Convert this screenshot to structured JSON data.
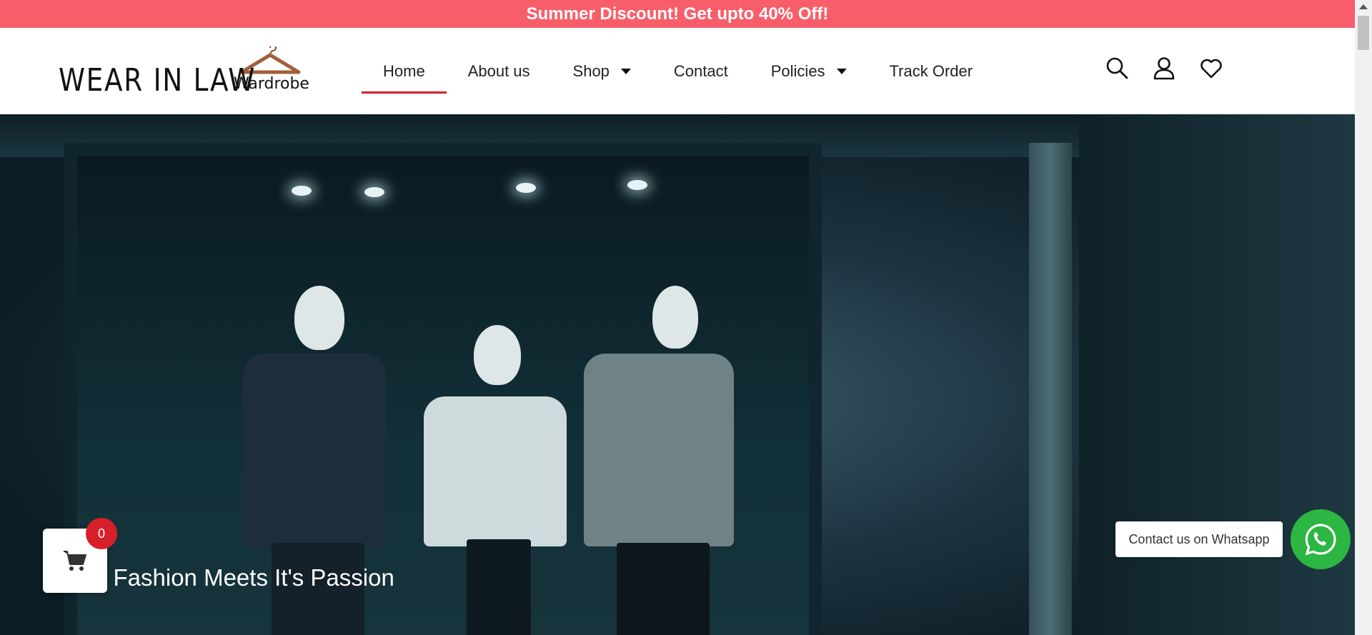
{
  "announcement": {
    "text": "Summer Discount! Get upto 40% Off!"
  },
  "logo": {
    "main": "WEAR IN LAW",
    "sub": "Wardrobe"
  },
  "nav": {
    "items": [
      {
        "label": "Home"
      },
      {
        "label": "About us"
      },
      {
        "label": "Shop"
      },
      {
        "label": "Contact"
      },
      {
        "label": "Policies"
      },
      {
        "label": "Track Order"
      }
    ]
  },
  "header_icons": [
    "search-icon",
    "user-icon",
    "heart-icon"
  ],
  "hero": {
    "tagline": "re Fashion Meets It's Passion"
  },
  "cart": {
    "count": "0"
  },
  "whatsapp": {
    "label": "Contact us on Whatsapp"
  },
  "colors": {
    "announcement_bg": "#f85e6a",
    "accent": "#d71f2a",
    "whatsapp": "#2bb741"
  }
}
